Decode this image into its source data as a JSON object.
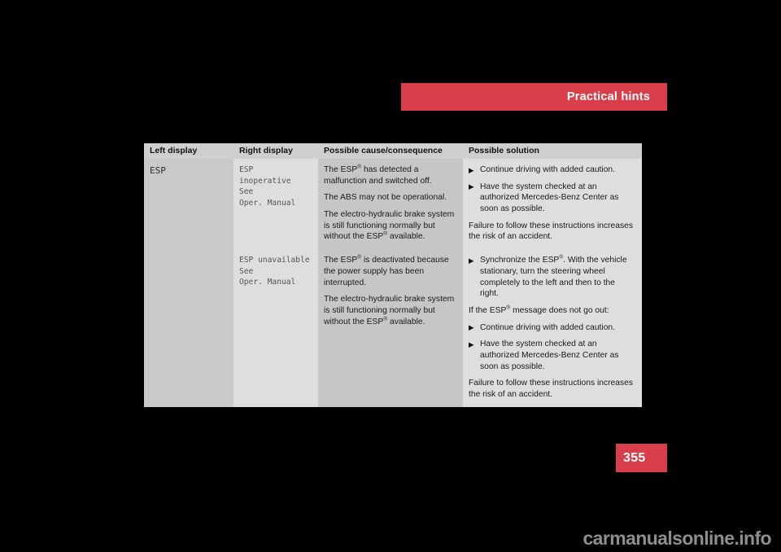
{
  "page": {
    "chapter_banner": {
      "title": "Practical hints",
      "color": "#d93f4a"
    },
    "page_number": "355",
    "watermark": "carmanualsonline.info"
  },
  "table": {
    "headers": [
      "Left display",
      "Right display",
      "Possible cause/consequence",
      "Possible solution"
    ],
    "rows": [
      {
        "left_display": "ESP",
        "right_display": "ESP\ninoperative\nSee\nOper. Manual",
        "cause": [
          "The ESP® has detected a malfunction and switched off.",
          "The ABS may not be operational.",
          "The electro-hydraulic brake system is still functioning normally but without the ESP® available."
        ],
        "solution": [
          {
            "type": "bullet",
            "text": "Continue driving with added caution."
          },
          {
            "type": "bullet",
            "text": "Have the system checked at an authorized Mercedes-Benz Center as soon as possible."
          },
          {
            "type": "para",
            "text": "Failure to follow these instructions increases the risk of an accident."
          }
        ]
      },
      {
        "left_display": "",
        "right_display": "ESP unavailable\nSee\nOper. Manual",
        "cause": [
          "The ESP® is deactivated because the power supply has been interrupted.",
          "The electro-hydraulic brake system is still functioning normally but without the ESP® available."
        ],
        "solution": [
          {
            "type": "bullet",
            "text": "Synchronize the ESP®. With the vehicle stationary, turn the steering wheel completely to the left and then to the right."
          },
          {
            "type": "para",
            "text": "If the ESP® message does not go out:"
          },
          {
            "type": "bullet",
            "text": "Continue driving with added caution."
          },
          {
            "type": "bullet",
            "text": "Have the system checked at an authorized Mercedes-Benz Center as soon as possible."
          },
          {
            "type": "para",
            "text": "Failure to follow these instructions increases the risk of an accident."
          }
        ]
      }
    ]
  },
  "icons": {
    "bullet": "▶"
  }
}
